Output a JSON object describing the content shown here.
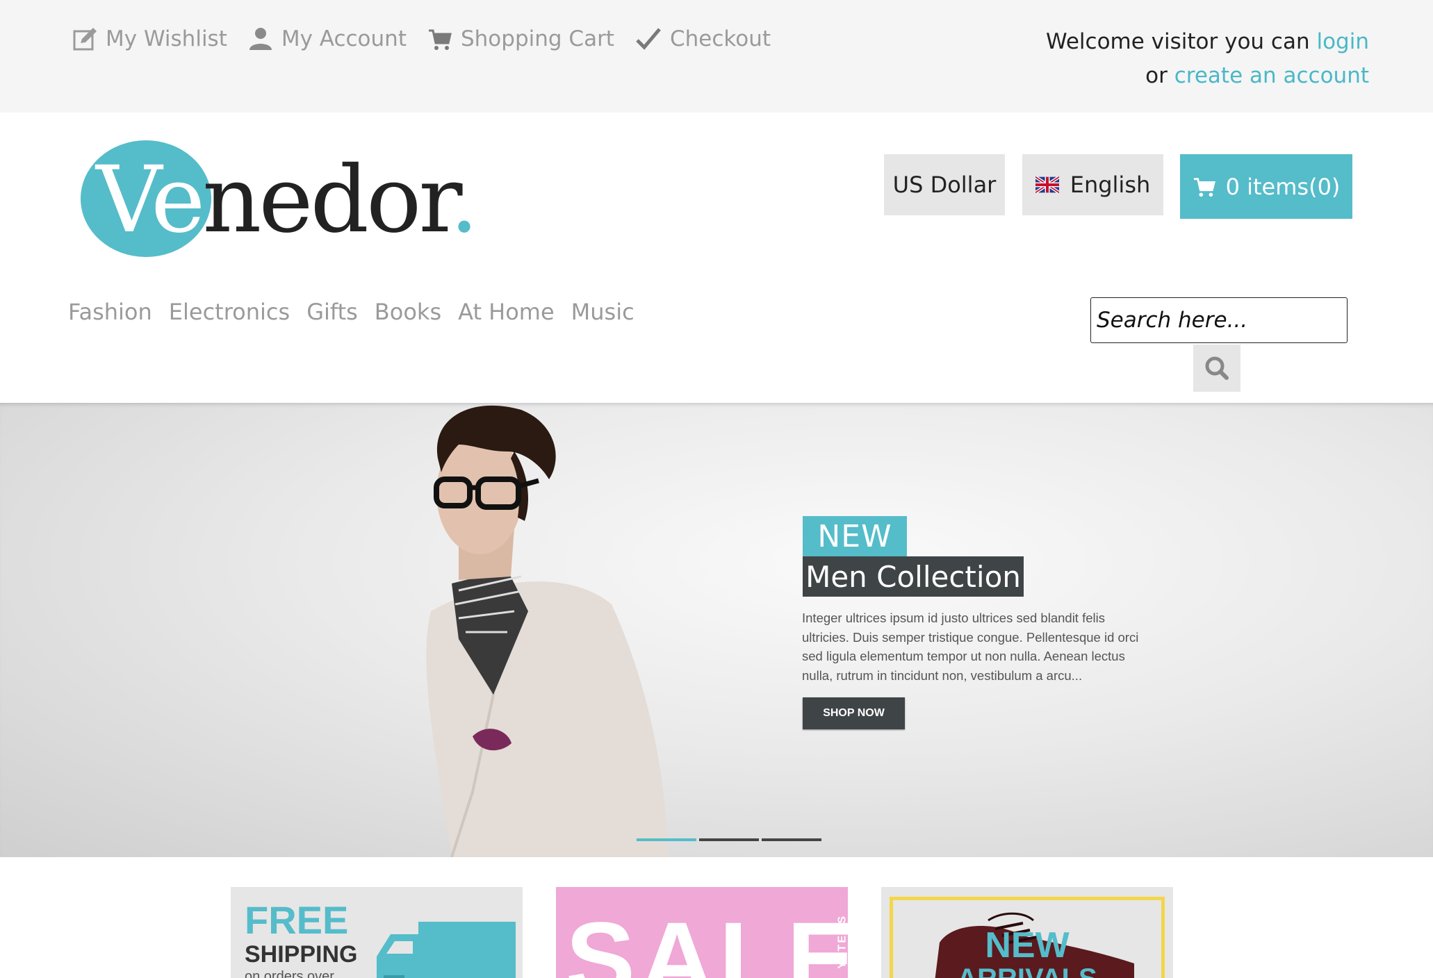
{
  "topbar": {
    "links": [
      "My Wishlist",
      "My Account",
      "Shopping Cart",
      "Checkout"
    ],
    "welcome_text": "Welcome visitor you can",
    "login_link": "login",
    "or_text": "or",
    "create_account_link": "create an account"
  },
  "logo": {
    "part1": "Ve",
    "part2": "nedor",
    "dot": "."
  },
  "header": {
    "currency_label": "US Dollar",
    "language_label": "English",
    "cart_label": "0 items(0)"
  },
  "nav": {
    "items": [
      "Fashion",
      "Electronics",
      "Gifts",
      "Books",
      "At Home",
      "Music"
    ]
  },
  "search": {
    "placeholder": "Search here..."
  },
  "hero": {
    "badge_new": "NEW",
    "badge_collection": "Men Collection",
    "description": "Integer ultrices ipsum id justo ultrices sed blandit felis ultricies. Duis semper tristique congue. Pellentesque id orci sed ligula elementum tempor ut non nulla. Aenean lectus nulla, rutrum in tincidunt non, vestibulum a arcu...",
    "button_label": "SHOP NOW",
    "slides_count": 3,
    "active_slide": 1
  },
  "promos": {
    "free_title": "FREE",
    "free_sub": "SHIPPING",
    "free_note": "on orders over",
    "sale_title": "SALE",
    "sale_side": "Y ITEMS",
    "new_title": "NEW",
    "new_sub": "ARRIVALS"
  },
  "colors": {
    "accent": "#55bcca",
    "dark": "#3f4446",
    "link_gray": "#9a9a9a",
    "sale_pink": "#f0a8d6"
  }
}
